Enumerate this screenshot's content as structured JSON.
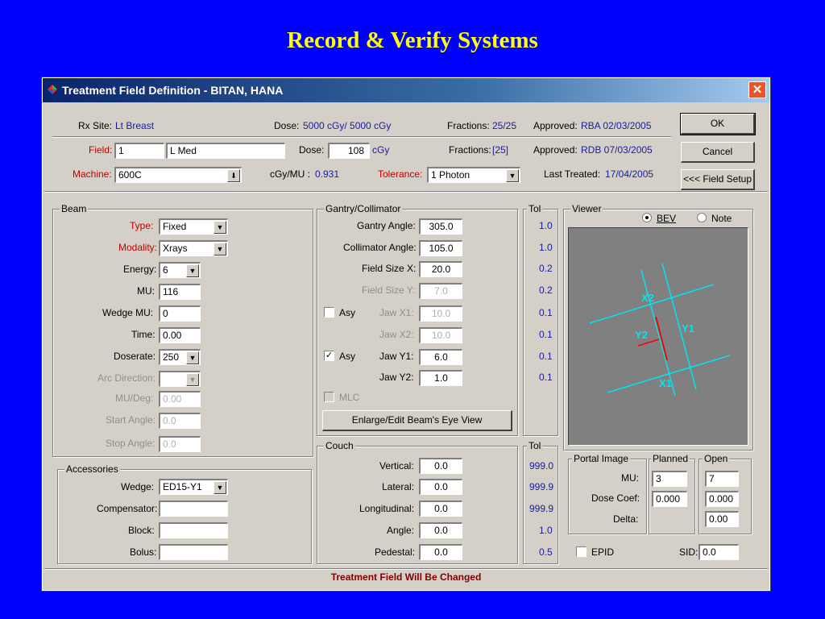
{
  "slide": {
    "title": "Record & Verify Systems"
  },
  "window": {
    "title": "Treatment Field Definition - BITAN, HANA",
    "close": "✕"
  },
  "rx": {
    "site_label": "Rx Site:",
    "site": "Lt Breast",
    "dose_label": "Dose:",
    "dose": "5000 cGy/ 5000 cGy",
    "fractions_label": "Fractions:",
    "fractions": "25/25",
    "approved_label": "Approved:",
    "approved": "RBA  02/03/2005"
  },
  "field": {
    "field_label": "Field:",
    "field_num": "1",
    "field_name": "L Med",
    "dose_label": "Dose:",
    "dose_value": "108",
    "dose_unit": "cGy",
    "fractions_label": "Fractions:",
    "fractions": "[25]",
    "approved_label": "Approved:",
    "approved": "RDB  07/03/2005"
  },
  "machine": {
    "label": "Machine:",
    "value": "600C",
    "cgy_mu_label": "cGy/MU :",
    "cgy_mu": "0.931",
    "tolerance_label": "Tolerance:",
    "tolerance": "1  Photon",
    "last_treated_label": "Last Treated:",
    "last_treated": "17/04/2005"
  },
  "buttons": {
    "ok": "OK",
    "cancel": "Cancel",
    "field_setup": "<<< Field Setup",
    "enlarge": "Enlarge/Edit Beam's Eye View"
  },
  "beam": {
    "title": "Beam",
    "type_label": "Type:",
    "type": "Fixed",
    "modality_label": "Modality:",
    "modality": "Xrays",
    "energy_label": "Energy:",
    "energy": "6",
    "mu_label": "MU:",
    "mu": "116",
    "wedge_mu_label": "Wedge MU:",
    "wedge_mu": "0",
    "time_label": "Time:",
    "time": "0.00",
    "doserate_label": "Doserate:",
    "doserate": "250",
    "arc_direction_label": "Arc Direction:",
    "mu_deg_label": "MU/Deg:",
    "mu_deg": "0.00",
    "start_angle_label": "Start Angle:",
    "start_angle": "0.0",
    "stop_angle_label": "Stop Angle:",
    "stop_angle": "0.0"
  },
  "accessories": {
    "title": "Accessories",
    "wedge_label": "Wedge:",
    "wedge": "ED15-Y1",
    "compensator_label": "Compensator:",
    "block_label": "Block:",
    "bolus_label": "Bolus:"
  },
  "gantry": {
    "title": "Gantry/Collimator",
    "gantry_angle_label": "Gantry Angle:",
    "gantry_angle": "305.0",
    "collimator_angle_label": "Collimator Angle:",
    "collimator_angle": "105.0",
    "field_size_x_label": "Field Size X:",
    "field_size_x": "20.0",
    "field_size_y_label": "Field Size Y:",
    "field_size_y": "7.0",
    "asy_label": "Asy",
    "jaw_x1_label": "Jaw X1:",
    "jaw_x1": "10.0",
    "jaw_x2_label": "Jaw X2:",
    "jaw_x2": "10.0",
    "jaw_y1_label": "Jaw Y1:",
    "jaw_y1": "6.0",
    "jaw_y2_label": "Jaw Y2:",
    "jaw_y2": "1.0",
    "mlc_label": "MLC",
    "check_mark": "✓"
  },
  "tol": {
    "title": "Tol",
    "gantry": [
      "1.0",
      "1.0",
      "0.2",
      "0.2",
      "0.1",
      "0.1",
      "0.1",
      "0.1"
    ],
    "couch": [
      "999.0",
      "999.9",
      "999.9",
      "1.0",
      "0.5"
    ]
  },
  "couch": {
    "title": "Couch",
    "vertical_label": "Vertical:",
    "vertical": "0.0",
    "lateral_label": "Lateral:",
    "lateral": "0.0",
    "longitudinal_label": "Longitudinal:",
    "longitudinal": "0.0",
    "angle_label": "Angle:",
    "angle": "0.0",
    "pedestal_label": "Pedestal:",
    "pedestal": "0.0"
  },
  "viewer": {
    "title": "Viewer",
    "bev": "BEV",
    "note": "Note",
    "x1": "X1",
    "x2": "X2",
    "y1": "Y1",
    "y2": "Y2",
    "line_color": "#00e5ee",
    "wedge_color": "#ff0000"
  },
  "portal": {
    "title": "Portal Image",
    "planned": "Planned",
    "open": "Open",
    "mu_label": "MU:",
    "mu_planned": "3",
    "mu_open": "7",
    "dose_coef_label": "Dose Coef:",
    "dose_coef_planned": "0.000",
    "dose_coef_open": "0.000",
    "delta_label": "Delta:",
    "delta_open": "0.00",
    "epid_label": "EPID",
    "sid_label": "SID:",
    "sid": "0.0"
  },
  "status": "Treatment Field Will Be Changed"
}
